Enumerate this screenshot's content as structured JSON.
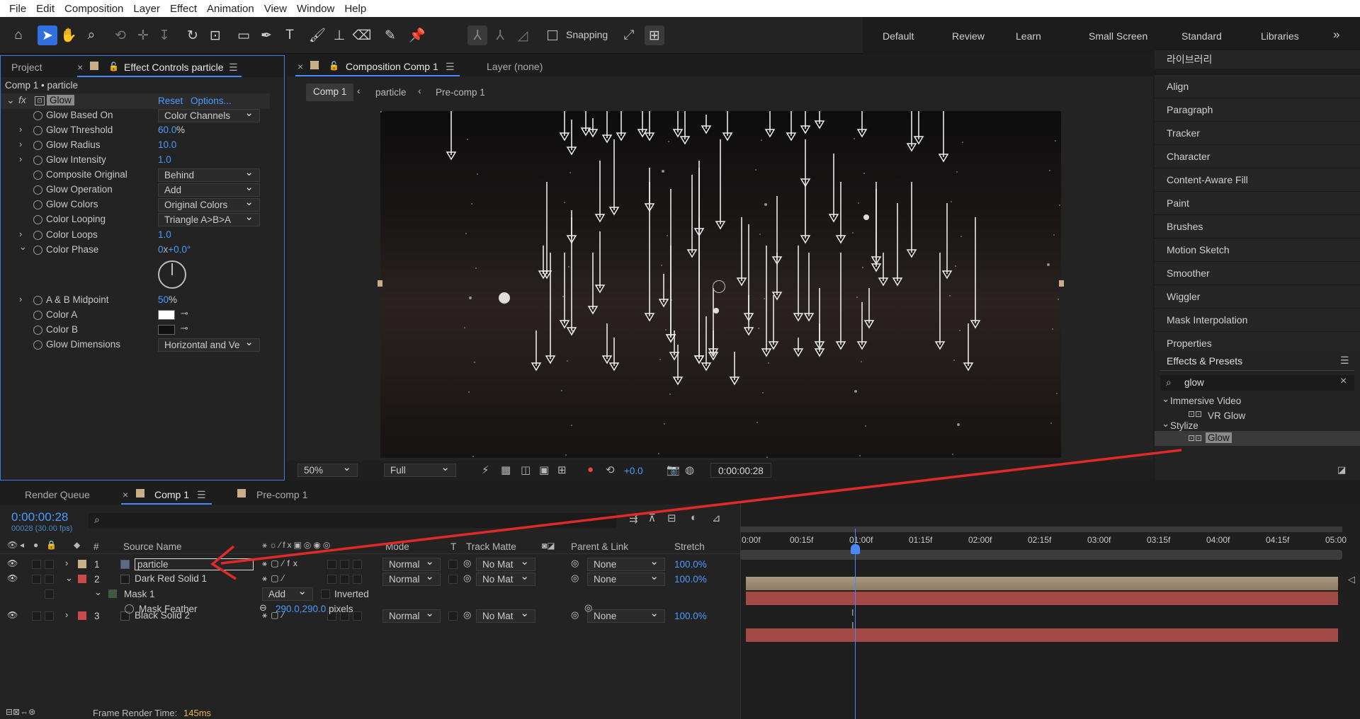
{
  "menu": [
    "File",
    "Edit",
    "Composition",
    "Layer",
    "Effect",
    "Animation",
    "View",
    "Window",
    "Help"
  ],
  "toolbar": {
    "snapping": "Snapping"
  },
  "workspaces": [
    "Default",
    "Review",
    "Learn",
    "Small Screen",
    "Standard",
    "Libraries"
  ],
  "left_panel": {
    "tab_project": "Project",
    "tab_effect_controls": "Effect Controls particle",
    "breadcrumb": "Comp 1 • particle",
    "effect_name": "Glow",
    "reset": "Reset",
    "options": "Options...",
    "props": [
      {
        "label": "Glow Based On",
        "value": "Color Channels",
        "kind": "dropdown"
      },
      {
        "label": "Glow Threshold",
        "value": "60.0",
        "unit": "%",
        "kind": "num",
        "twirl": true
      },
      {
        "label": "Glow Radius",
        "value": "10.0",
        "kind": "num",
        "twirl": true
      },
      {
        "label": "Glow Intensity",
        "value": "1.0",
        "kind": "num",
        "twirl": true
      },
      {
        "label": "Composite Original",
        "value": "Behind",
        "kind": "dropdown"
      },
      {
        "label": "Glow Operation",
        "value": "Add",
        "kind": "dropdown"
      },
      {
        "label": "Glow Colors",
        "value": "Original Colors",
        "kind": "dropdown"
      },
      {
        "label": "Color Looping",
        "value": "Triangle A>B>A",
        "kind": "dropdown"
      },
      {
        "label": "Color Loops",
        "value": "1.0",
        "kind": "num",
        "twirl": true
      },
      {
        "label": "Color Phase",
        "value_a": "0",
        "value_sep": "x",
        "value_b": "+0.0°",
        "kind": "angle",
        "twirl_open": true
      },
      {
        "label": "A & B Midpoint",
        "value": "50",
        "unit": "%",
        "kind": "num",
        "twirl": true
      },
      {
        "label": "Color A",
        "color": "#ffffff",
        "kind": "color"
      },
      {
        "label": "Color B",
        "color": "#111111",
        "kind": "color"
      },
      {
        "label": "Glow Dimensions",
        "value": "Horizontal and Ve",
        "kind": "dropdown"
      }
    ]
  },
  "comp_panel": {
    "tab_comp": "Composition Comp 1",
    "tab_layer": "Layer (none)",
    "crumbs": [
      "Comp 1",
      "particle",
      "Pre-comp 1"
    ],
    "zoom": "50%",
    "quality": "Full",
    "exposure": "+0.0",
    "timecode": "0:00:00:28"
  },
  "right_panel": {
    "items": [
      "라이브러리",
      "Align",
      "Paragraph",
      "Tracker",
      "Character",
      "Content-Aware Fill",
      "Paint",
      "Brushes",
      "Motion Sketch",
      "Smoother",
      "Wiggler",
      "Mask Interpolation",
      "Properties"
    ],
    "effects_presets": "Effects & Presets",
    "search_value": "glow",
    "group1": "Immersive Video",
    "group1_item": "VR Glow",
    "group2": "Stylize",
    "group2_item": "Glow"
  },
  "timeline": {
    "tab_render": "Render Queue",
    "tab_comp1": "Comp 1",
    "tab_precomp": "Pre-comp 1",
    "timecode": "0:00:00:28",
    "frames": "00028 (30.00 fps)",
    "col_num": "#",
    "col_source": "Source Name",
    "col_mode": "Mode",
    "col_t": "T",
    "col_matte": "Track Matte",
    "col_parent": "Parent & Link",
    "col_stretch": "Stretch",
    "ruler": [
      "0:00f",
      "00:15f",
      "01:00f",
      "01:15f",
      "02:00f",
      "02:15f",
      "03:00f",
      "03:15f",
      "04:00f",
      "04:15f",
      "05:00"
    ],
    "layers": [
      {
        "num": "1",
        "name": "particle",
        "mode": "Normal",
        "matte": "No Mat",
        "parent": "None",
        "stretch": "100.0%",
        "label_color": "#c8b08a"
      },
      {
        "num": "2",
        "name": "Dark Red Solid 1",
        "mode": "Normal",
        "matte": "No Mat",
        "parent": "None",
        "stretch": "100.0%",
        "label_color": "#c84a4a"
      },
      {
        "num": "3",
        "name": "Black Solid 2",
        "mode": "Normal",
        "matte": "No Mat",
        "parent": "None",
        "stretch": "100.0%",
        "label_color": "#c84a4a"
      }
    ],
    "mask": {
      "name": "Mask 1",
      "mode": "Add",
      "inverted": "Inverted",
      "feather_label": "Mask Feather",
      "feather_value": "290.0,290.0",
      "feather_unit": "pixels"
    },
    "render_time_label": "Frame Render Time:",
    "render_time_value": "145ms"
  },
  "colors": {
    "accent": "#4a88ff",
    "selection": "#2f6fe0",
    "arrow": "#e02a2a"
  }
}
